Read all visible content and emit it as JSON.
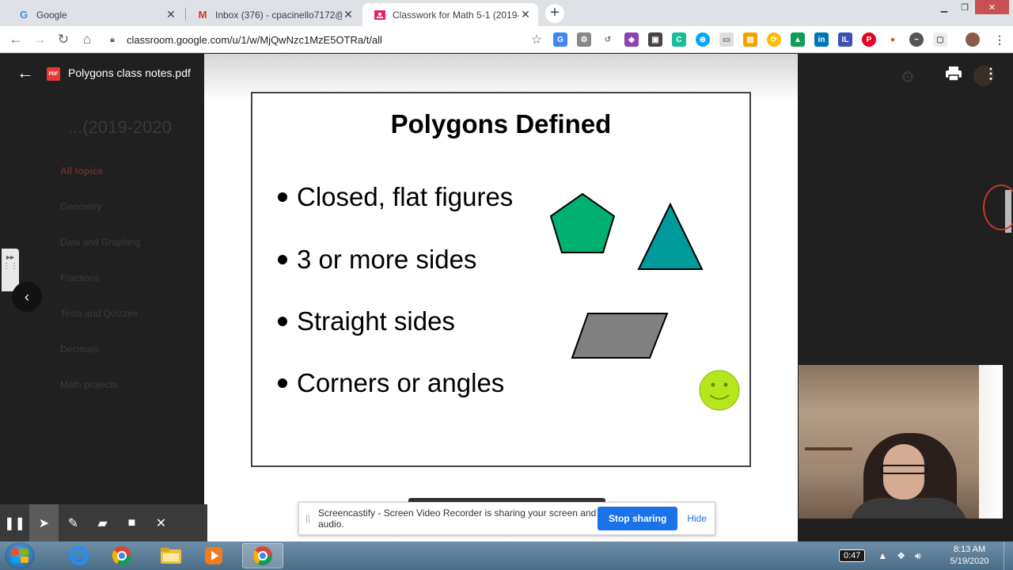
{
  "browser": {
    "tabs": [
      {
        "title": "Google",
        "favicon": "google-icon",
        "active": false
      },
      {
        "title": "Inbox (376) - cpacinello7172@sp",
        "favicon": "gmail-icon",
        "active": false
      },
      {
        "title": "Classwork for Math 5-1 (2019- 20",
        "favicon": "classroom-icon",
        "active": true
      }
    ],
    "new_tab_label": "+",
    "url": "classroom.google.com/u/1/w/MjQwNzc1MzE5OTRa/t/all"
  },
  "classroom": {
    "title": "...(2019-2020",
    "topics": [
      "All topics",
      "Geometry",
      "Data and Graphing",
      "Fractions",
      "Tests and Quizzes",
      "Decimals",
      "Math projects"
    ]
  },
  "pdf_viewer": {
    "file_badge": "PDF",
    "file_name": "Polygons class notes.pdf"
  },
  "slide": {
    "title": "Polygons Defined",
    "bullets": [
      "Closed, flat figures",
      "3 or more sides",
      "Straight sides",
      "Corners or angles"
    ],
    "colors": {
      "pentagon": "#00b070",
      "triangle": "#009a9a",
      "parallelogram": "#808080",
      "smiley": "#b5e61d"
    }
  },
  "screencastify": {
    "share_message": "Screencastify - Screen Video Recorder is sharing your screen and audio.",
    "stop_label": "Stop sharing",
    "hide_label": "Hide"
  },
  "taskbar": {
    "battery": "0:47",
    "time": "8:13 AM",
    "date": "5/19/2020"
  }
}
